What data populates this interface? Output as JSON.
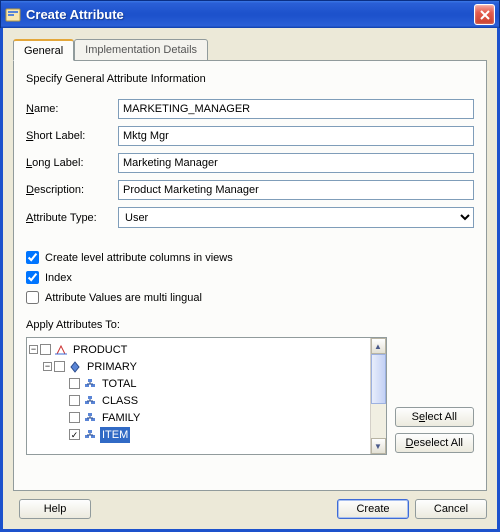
{
  "title": "Create Attribute",
  "tabs": {
    "general": "General",
    "impl": "Implementation Details"
  },
  "section_title": "Specify General Attribute Information",
  "labels": {
    "name": "Name:",
    "short_label": "Short Label:",
    "long_label": "Long Label:",
    "description": "Description:",
    "attr_type": "Attribute Type:"
  },
  "fields": {
    "name": "MARKETING_MANAGER",
    "short_label": "Mktg Mgr",
    "long_label": "Marketing Manager",
    "description": "Product Marketing Manager",
    "attr_type": "User"
  },
  "checks": {
    "create_cols": "Create level attribute columns in views",
    "index": "Index",
    "multilingual": "Attribute Values are multi lingual"
  },
  "apply_label": "Apply Attributes To:",
  "tree": {
    "product": "PRODUCT",
    "primary": "PRIMARY",
    "total": "TOTAL",
    "class": "CLASS",
    "family": "FAMILY",
    "item": "ITEM"
  },
  "buttons": {
    "select_all": "Select All",
    "deselect_all": "Deselect All",
    "help": "Help",
    "create": "Create",
    "cancel": "Cancel"
  }
}
